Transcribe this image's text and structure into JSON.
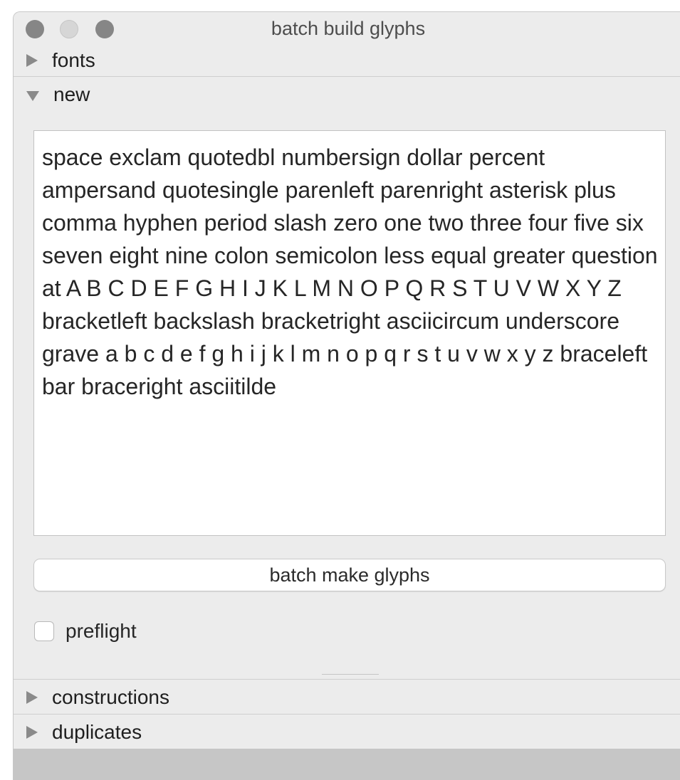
{
  "window": {
    "title": "batch build glyphs"
  },
  "sections": {
    "fonts": {
      "label": "fonts",
      "expanded": false,
      "icon": "disclosure-triangle-right-icon"
    },
    "new": {
      "label": "new",
      "expanded": true,
      "icon": "disclosure-triangle-down-icon"
    },
    "constructions": {
      "label": "constructions",
      "expanded": false,
      "icon": "disclosure-triangle-right-icon"
    },
    "duplicates": {
      "label": "duplicates",
      "expanded": false,
      "icon": "disclosure-triangle-right-icon"
    }
  },
  "new_panel": {
    "glyph_names": "space exclam quotedbl numbersign dollar percent ampersand quotesingle parenleft parenright asterisk plus comma hyphen period slash zero one two three four five six seven eight nine colon semicolon less equal greater question at A B C D E F G H I J K L M N O P Q R S T U V W X Y Z bracketleft backslash bracketright asciicircum underscore grave a b c d e f g h i j k l m n o p q r s t u v w x y z braceleft bar braceright asciitilde",
    "button_label": "batch make glyphs",
    "preflight_label": "preflight",
    "preflight_checked": false
  }
}
